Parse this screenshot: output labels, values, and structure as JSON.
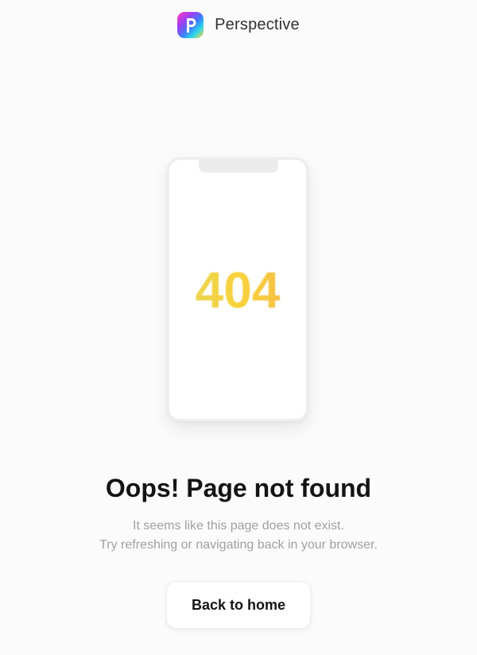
{
  "brand": {
    "name": "Perspective",
    "logo_icon": "perspective-p-logo",
    "logo_letter": "P"
  },
  "illustration": {
    "error_code": "404",
    "device": "phone-outline"
  },
  "message": {
    "title": "Oops! Page not found",
    "line1": "It seems like this page does not exist.",
    "line2": "Try refreshing or navigating back in your browser."
  },
  "actions": {
    "home_label": "Back to home"
  },
  "colors": {
    "background": "#fbfbfb",
    "title": "#141414",
    "subtitle": "#a0a0a0",
    "code_gradient_start": "#e4d75e",
    "code_gradient_end": "#f7b84a"
  }
}
